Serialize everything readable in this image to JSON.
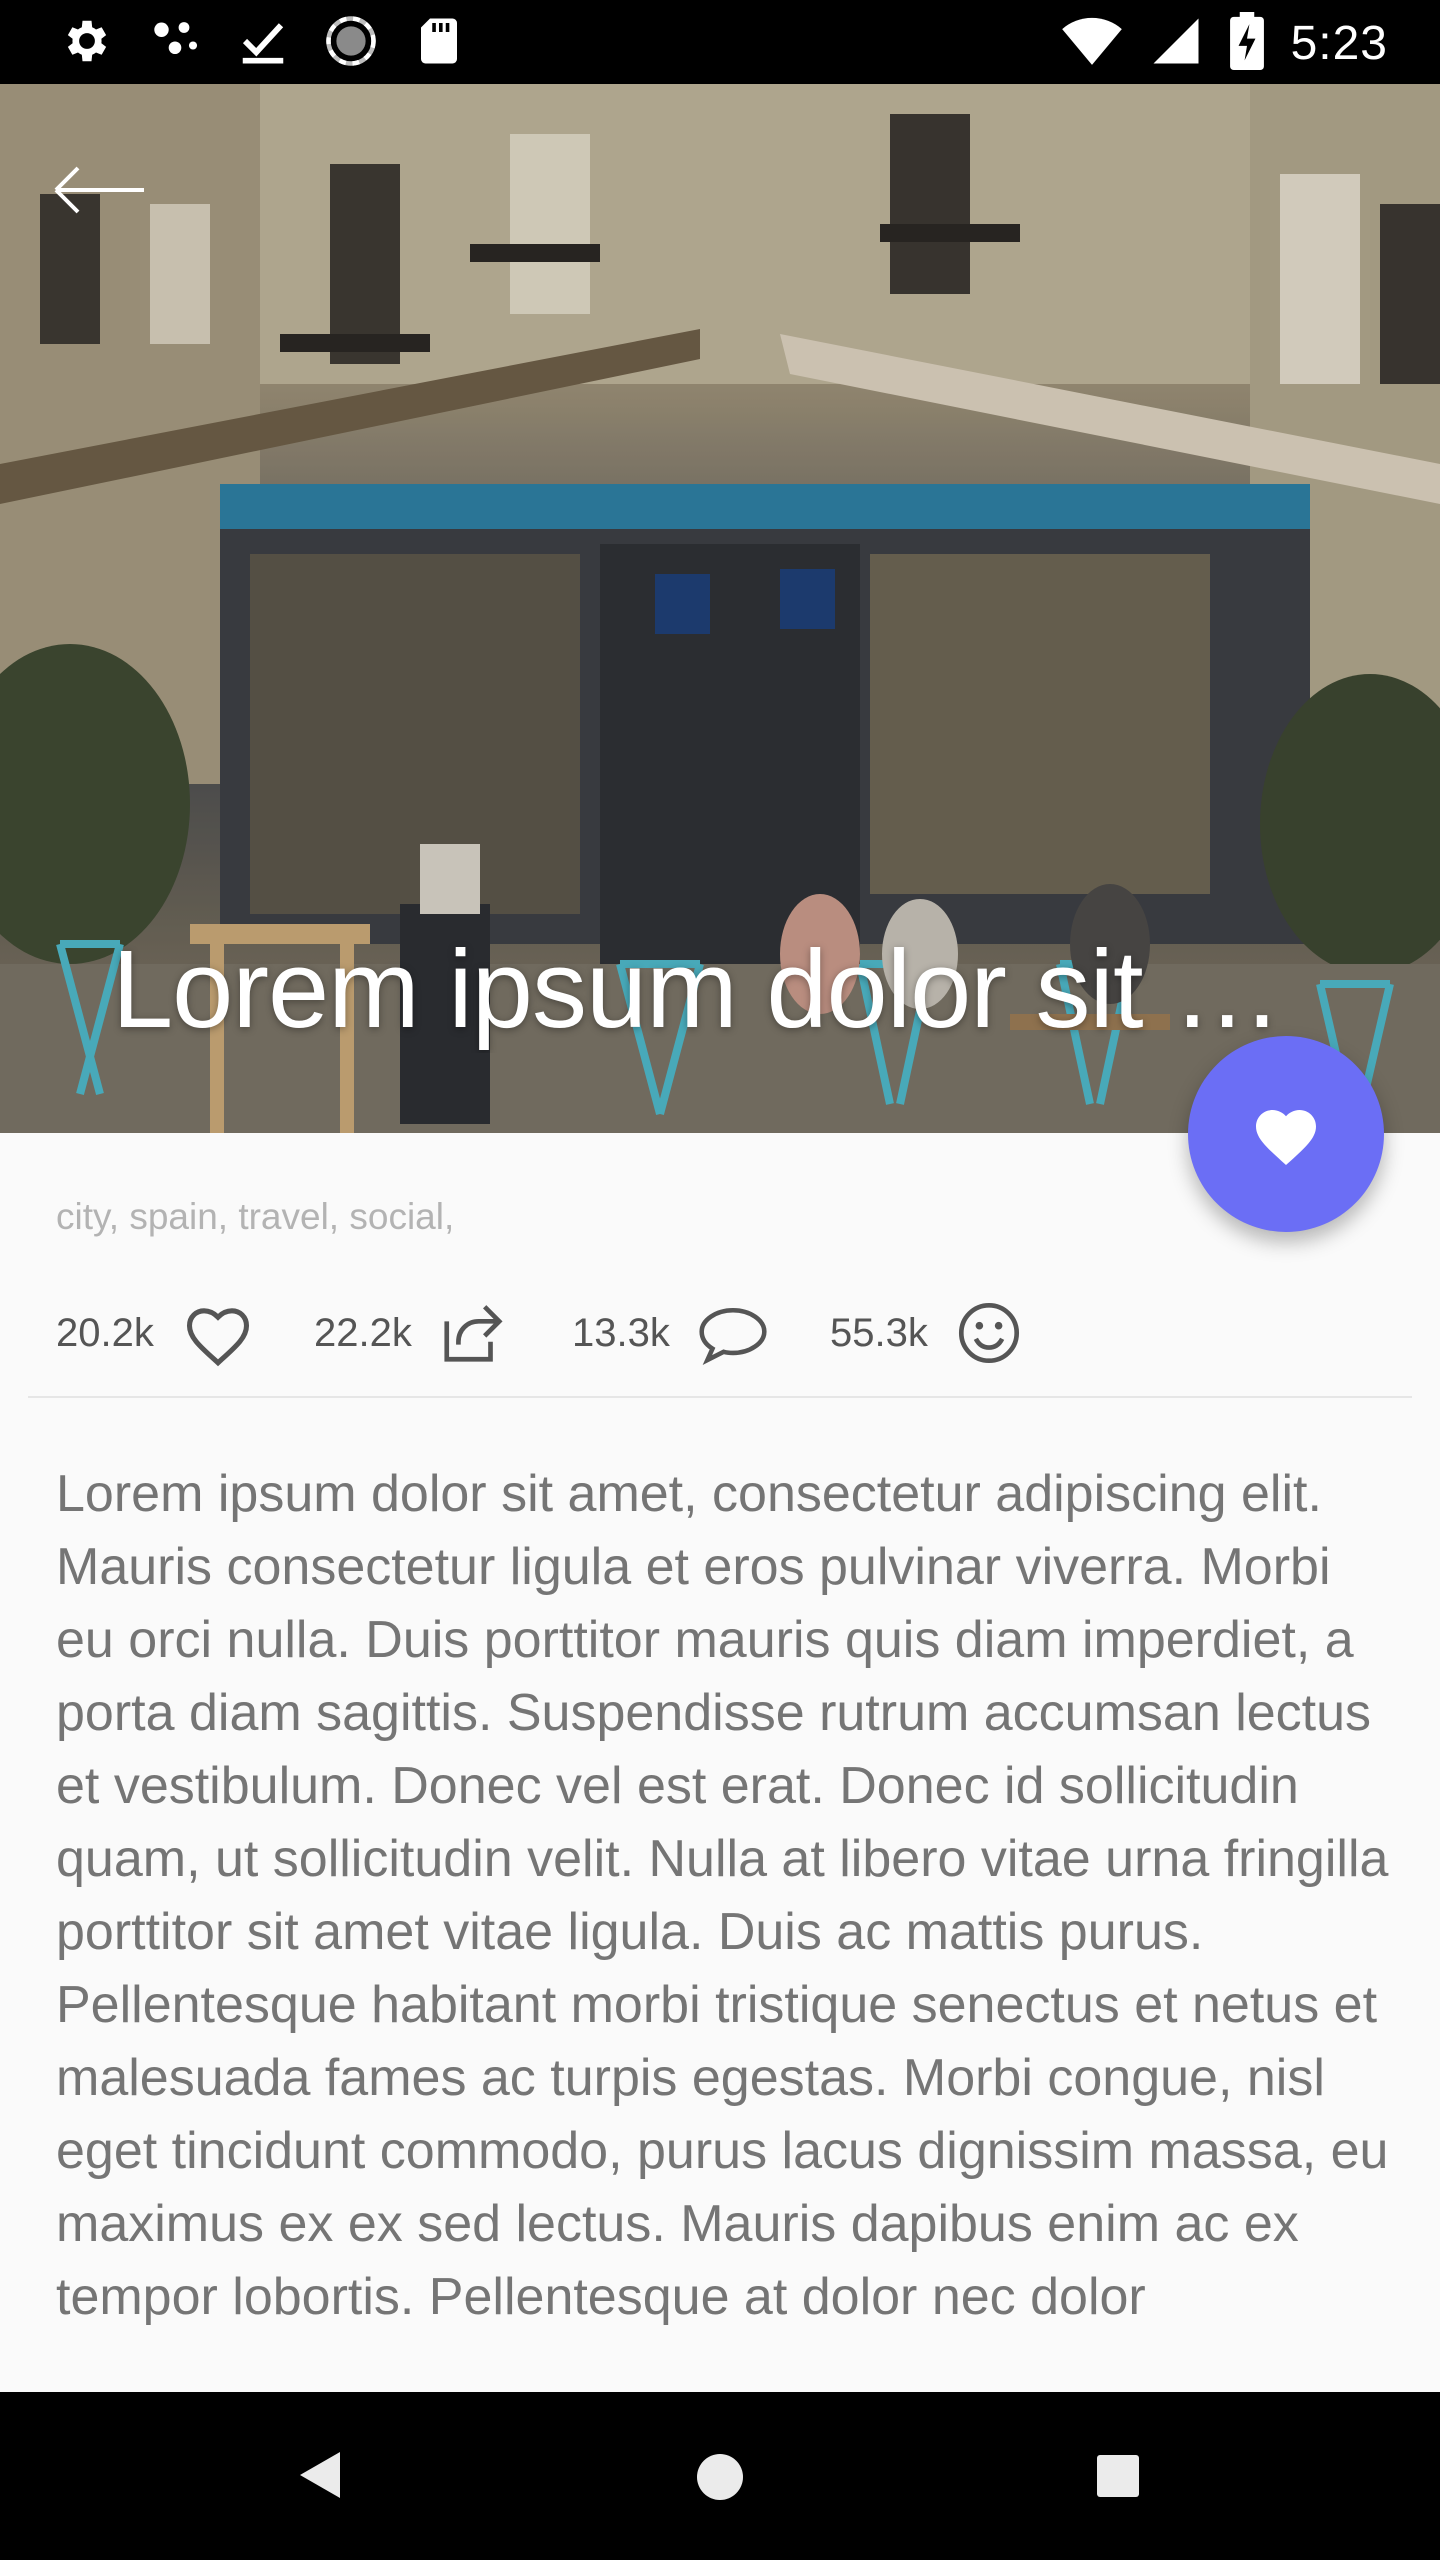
{
  "status_bar": {
    "time": "5:23",
    "left_icons": [
      "settings-icon",
      "share-nodes-icon",
      "download-done-icon",
      "sync-icon",
      "sd-card-icon"
    ],
    "right_icons": [
      "wifi-icon",
      "signal-icon",
      "battery-charging-icon"
    ]
  },
  "hero": {
    "title": "Lorem ipsum dolor sit amet",
    "title_display": "Lorem ipsum dolor si...",
    "back_icon": "arrow-left-icon"
  },
  "fab": {
    "icon": "heart-filled-icon",
    "color": "#6b6ef5"
  },
  "tags": "city, spain, travel, social,",
  "stats": [
    {
      "count": "20.2k",
      "icon": "heart-outline-icon"
    },
    {
      "count": "22.2k",
      "icon": "share-icon"
    },
    {
      "count": "13.3k",
      "icon": "comment-icon"
    },
    {
      "count": "55.3k",
      "icon": "smiley-icon"
    }
  ],
  "body": "Lorem ipsum dolor sit amet, consectetur adipiscing elit. Mauris consectetur ligula et eros pulvinar viverra. Morbi eu orci nulla. Duis porttitor mauris quis diam imperdiet, a porta diam sagittis. Suspendisse rutrum accumsan lectus et vestibulum. Donec vel est erat. Donec id sollicitudin quam, ut sollicitudin velit. Nulla at libero vitae urna fringilla porttitor sit amet vitae ligula. Duis ac mattis purus. Pellentesque habitant morbi tristique senectus et netus et malesuada fames ac turpis egestas. Morbi congue, nisl eget tincidunt commodo, purus lacus dignissim massa, eu maximus ex ex sed lectus. Mauris dapibus enim ac ex tempor lobortis. Pellentesque at dolor nec dolor",
  "nav_bar": {
    "buttons": [
      "back-triangle-icon",
      "home-circle-icon",
      "recents-square-icon"
    ]
  }
}
